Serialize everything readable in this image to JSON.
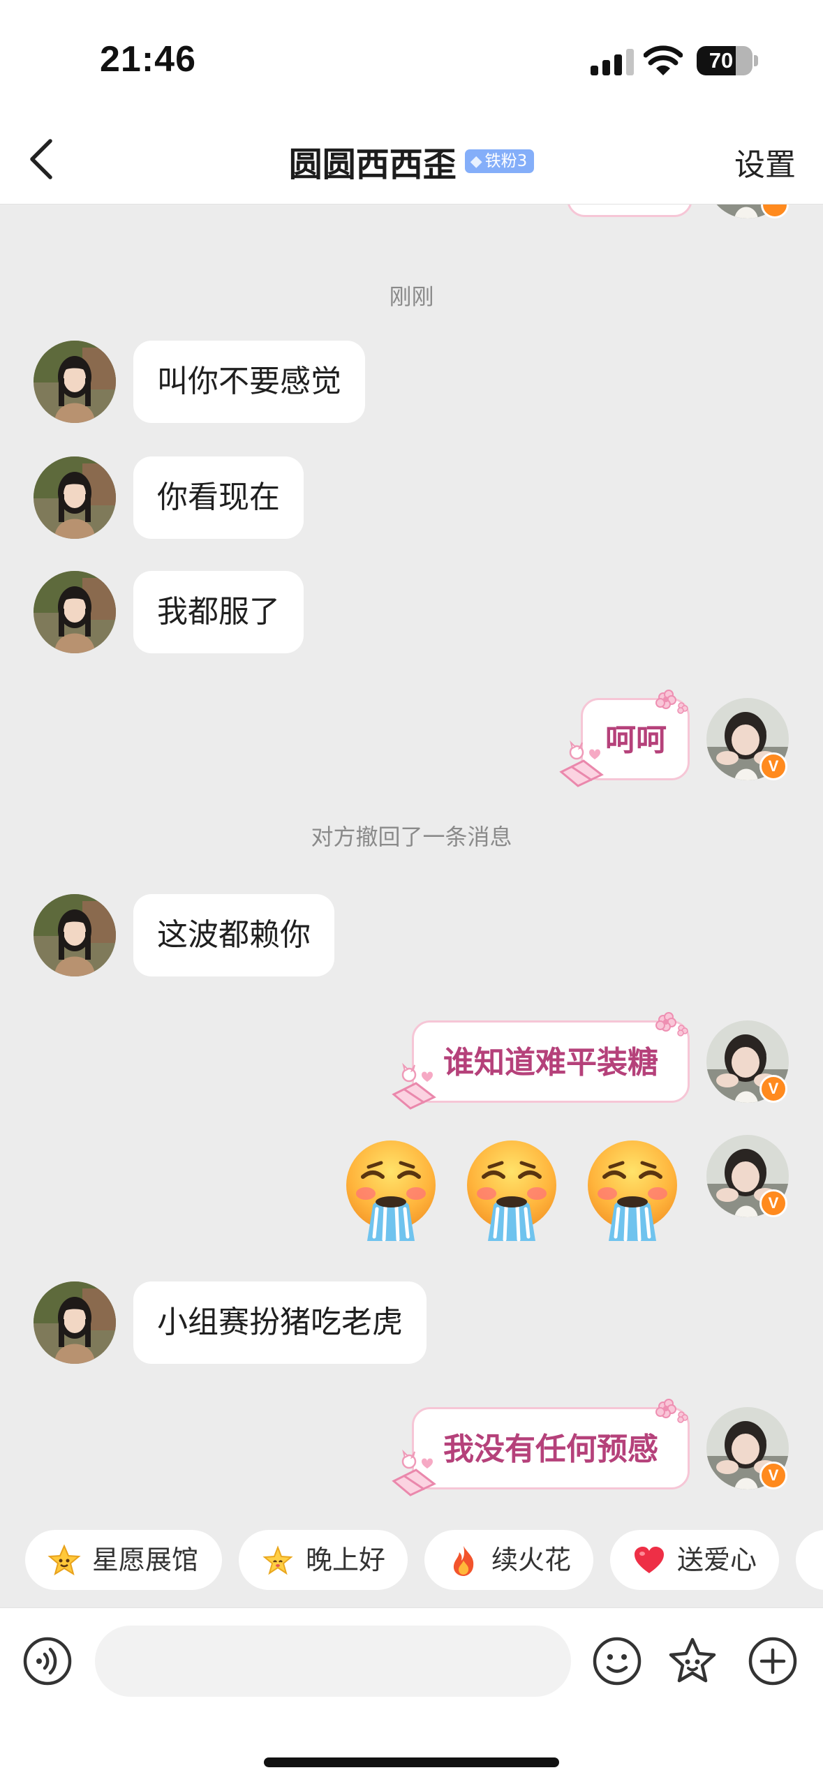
{
  "status_bar": {
    "time": "21:46",
    "battery": "70",
    "battery_level_percent": 70
  },
  "header": {
    "title": "圆圆西西歪",
    "fan_badge": "铁粉3",
    "settings_label": "设置"
  },
  "chat": {
    "timestamp": "刚刚",
    "recall_notice": "对方撤回了一条消息",
    "incoming": [
      "叫你不要感觉",
      "你看现在",
      "我都服了",
      "这波都赖你",
      "小组赛扮猪吃老虎"
    ],
    "outgoing": [
      "呵呵",
      "谁知道难平装糖",
      "我没有任何预感"
    ],
    "emoji_row": [
      "steam-face",
      "steam-face",
      "steam-face"
    ]
  },
  "quick_replies": [
    {
      "label": "星愿展馆",
      "icon": "smiling-star-icon"
    },
    {
      "label": "晚上好",
      "icon": "sparkle-star-icon"
    },
    {
      "label": "续火花",
      "icon": "fire-icon"
    },
    {
      "label": "送爱心",
      "icon": "heart-icon"
    }
  ],
  "input_bar": {
    "placeholder": ""
  },
  "colors": {
    "outgoing_text": "#b5417a",
    "outgoing_border": "#f6c6d6",
    "fan_badge": "#84aef9",
    "verified_badge": "#ff8a1e",
    "chat_background": "#ececec"
  }
}
